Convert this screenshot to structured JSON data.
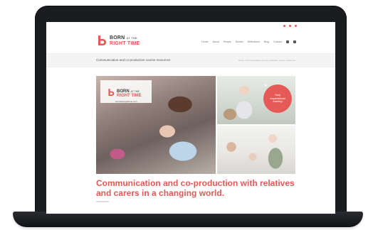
{
  "brand": {
    "line1": "BORN",
    "line1_suffix": "AT THE",
    "line2": "RIGHT TIME",
    "accent_color": "#e05a57",
    "text_color": "#3a3a3a"
  },
  "topbar": {
    "social_icons": [
      "social-icon-1",
      "social-icon-2",
      "social-icon-3"
    ]
  },
  "nav": {
    "items": [
      "Home",
      "About",
      "People",
      "Stories",
      "Reflections",
      "Blog",
      "Contact"
    ],
    "icons": [
      "cart-icon",
      "search-icon"
    ]
  },
  "subheader": {
    "title": "Communication and co-production course resources",
    "breadcrumb": "Home / Communication and co-production course resources"
  },
  "hero": {
    "logo_line1": "BORN",
    "logo_line1_suffix": "AT THE",
    "logo_line2": "RIGHT TIME",
    "url": "bornattherighttime.com",
    "quote": "Truly inspirational training"
  },
  "headline": "Communication and co-production with relatives and carers in a changing world."
}
